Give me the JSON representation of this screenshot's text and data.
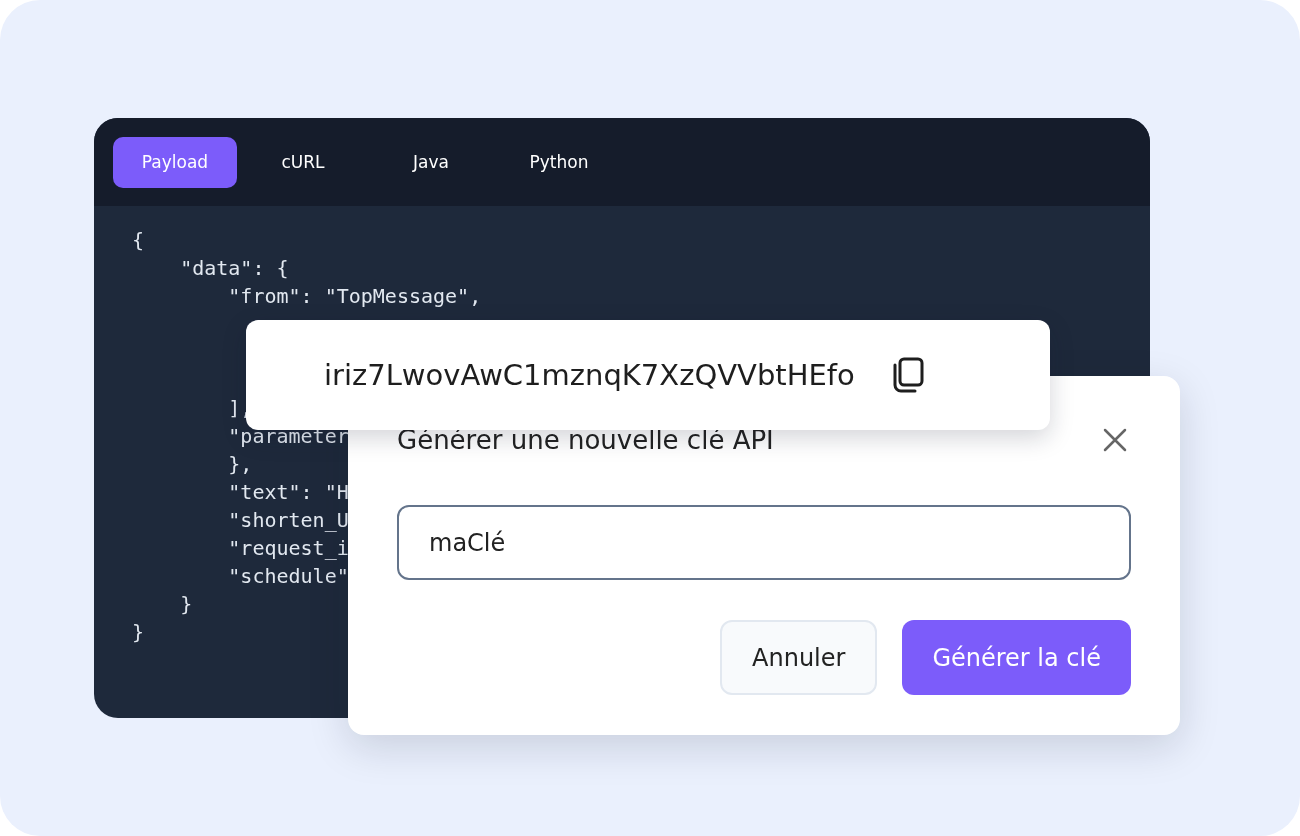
{
  "code_panel": {
    "tabs": [
      {
        "label": "Payload",
        "selected": true
      },
      {
        "label": "cURL",
        "selected": false
      },
      {
        "label": "Java",
        "selected": false
      },
      {
        "label": "Python",
        "selected": false
      }
    ],
    "lines": [
      {
        "kind": "code",
        "text": "{"
      },
      {
        "kind": "code",
        "text": "    \"data\": {"
      },
      {
        "kind": "code",
        "text": "        \"from\": \"TopMessage\","
      },
      {
        "kind": "covered"
      },
      {
        "kind": "covered"
      },
      {
        "kind": "covered"
      },
      {
        "kind": "code",
        "text": "        ],"
      },
      {
        "kind": "code",
        "text": "        \"parameter"
      },
      {
        "kind": "code",
        "text": "        },"
      },
      {
        "kind": "code",
        "text": "        \"text\": \"H"
      },
      {
        "kind": "code",
        "text": "        \"shorten_U"
      },
      {
        "kind": "code",
        "text": "        \"request_i"
      },
      {
        "kind": "code",
        "text": "        \"schedule\""
      },
      {
        "kind": "code",
        "text": "    }"
      },
      {
        "kind": "code",
        "text": "}"
      }
    ]
  },
  "key_card": {
    "key": "iriz7LwovAwC1mznqK7XzQVVbtHEfo"
  },
  "dialog": {
    "title": "Générer une nouvelle clé API",
    "name_field": {
      "value": "maClé"
    },
    "buttons": [
      {
        "label": "Annuler",
        "kind": "secondary"
      },
      {
        "label": "Générer la clé",
        "kind": "primary"
      }
    ]
  }
}
